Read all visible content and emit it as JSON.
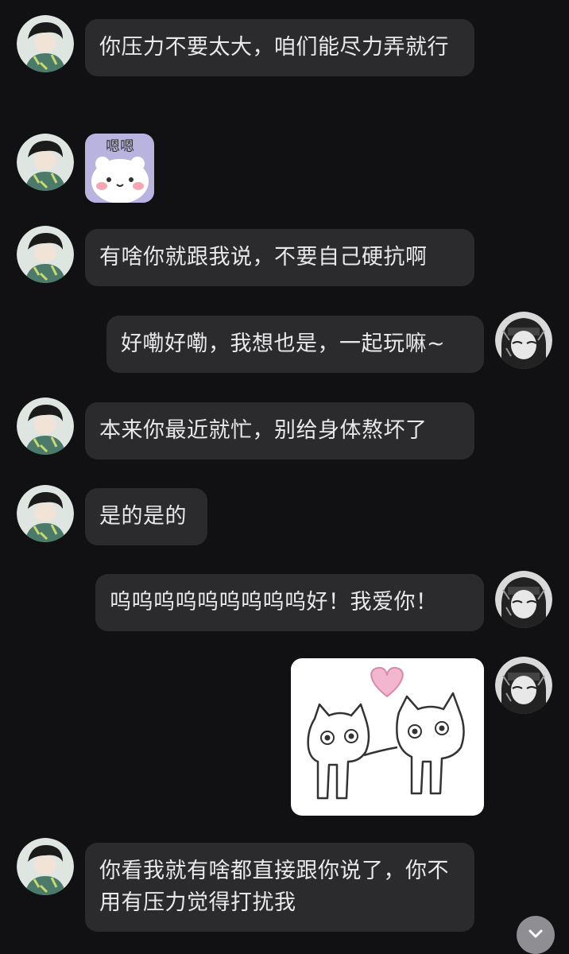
{
  "messages": [
    {
      "from": "friend",
      "type": "text",
      "text": "你压力不要太大，咱们能尽力弄就行"
    },
    {
      "from": "friend",
      "type": "sticker",
      "sticker": "bear-sticker",
      "caption": "嗯嗯"
    },
    {
      "from": "friend",
      "type": "text",
      "text": "有啥你就跟我说，不要自己硬抗啊"
    },
    {
      "from": "me",
      "type": "text",
      "text": "好嘞好嘞，我想也是，一起玩嘛~"
    },
    {
      "from": "friend",
      "type": "text",
      "text": "本来你最近就忙，别给身体熬坏了"
    },
    {
      "from": "friend",
      "type": "text",
      "text": "是的是的"
    },
    {
      "from": "me",
      "type": "text",
      "text": "呜呜呜呜呜呜呜呜呜好！我爱你！"
    },
    {
      "from": "me",
      "type": "sticker",
      "sticker": "two-cats-heart-sticker"
    },
    {
      "from": "friend",
      "type": "text",
      "text": "你看我就有啥都直接跟你说了，你不用有压力觉得打扰我"
    }
  ],
  "icons": {
    "scroll_down": "chevron-down-icon",
    "friend_avatar": "friend-avatar",
    "my_avatar": "my-avatar"
  },
  "colors": {
    "background": "#111113",
    "bubble": "#2b2b2e",
    "text": "#e9e9ea",
    "scroll_button": "#8e8e93"
  }
}
